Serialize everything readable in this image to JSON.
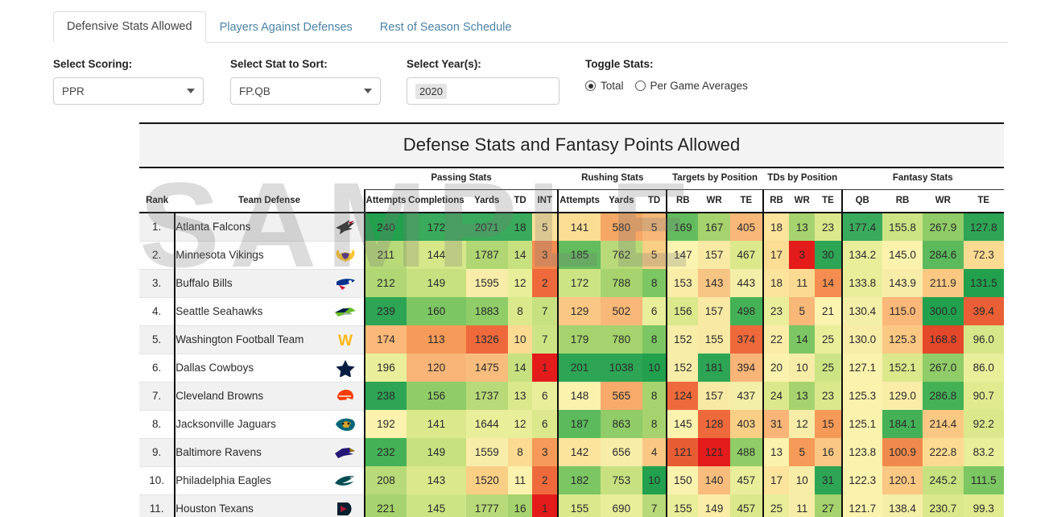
{
  "tabs": [
    {
      "label": "Defensive Stats Allowed",
      "active": true
    },
    {
      "label": "Players Against Defenses",
      "active": false
    },
    {
      "label": "Rest of Season Schedule",
      "active": false
    }
  ],
  "controls": {
    "scoring": {
      "label": "Select Scoring:",
      "value": "PPR"
    },
    "stat_sort": {
      "label": "Select Stat to Sort:",
      "value": "FP.QB"
    },
    "years": {
      "label": "Select Year(s):",
      "value": "2020"
    },
    "toggle": {
      "label": "Toggle Stats:",
      "options": [
        {
          "label": "Total",
          "selected": true
        },
        {
          "label": "Per Game Averages",
          "selected": false
        }
      ]
    }
  },
  "watermark": "SAMPLE",
  "table": {
    "title": "Defense Stats and Fantasy Points Allowed",
    "groups": [
      {
        "label": "",
        "span": 2,
        "rule": false
      },
      {
        "label": "Passing Stats",
        "span": 5,
        "rule": true
      },
      {
        "label": "Rushing Stats",
        "span": 3,
        "rule": true
      },
      {
        "label": "Targets by Position",
        "span": 3,
        "rule": true
      },
      {
        "label": "TDs by Position",
        "span": 3,
        "rule": true
      },
      {
        "label": "Fantasy Stats",
        "span": 4,
        "rule": true
      }
    ],
    "columns": [
      "Rank",
      "Team Defense",
      "Attempts",
      "Completions",
      "Yards",
      "TD",
      "INT",
      "Attempts",
      "Yards",
      "TD",
      "RB",
      "WR",
      "TE",
      "RB",
      "WR",
      "TE",
      "QB",
      "RB",
      "WR",
      "TE"
    ],
    "rows": [
      {
        "rank": "1.",
        "team": "Atlanta Falcons",
        "logo": "falcons",
        "cells": [
          {
            "v": "240",
            "c": "#22a04e"
          },
          {
            "v": "172",
            "c": "#3aaa5c"
          },
          {
            "v": "2071",
            "c": "#3aaa5c"
          },
          {
            "v": "18",
            "c": "#3aaa5c"
          },
          {
            "v": "5",
            "c": "#fde39a"
          },
          {
            "v": "141",
            "c": "#fcdd94"
          },
          {
            "v": "580",
            "c": "#f5a765"
          },
          {
            "v": "5",
            "c": "#f7b878"
          },
          {
            "v": "169",
            "c": "#63bc5e"
          },
          {
            "v": "167",
            "c": "#a6d36d"
          },
          {
            "v": "405",
            "c": "#f7b878"
          },
          {
            "v": "18",
            "c": "#fce49d"
          },
          {
            "v": "13",
            "c": "#a6d36d"
          },
          {
            "v": "23",
            "c": "#dbe88c"
          },
          {
            "v": "177.4",
            "c": "#3aaa5c"
          },
          {
            "v": "155.8",
            "c": "#cde485"
          },
          {
            "v": "267.9",
            "c": "#90cc68"
          },
          {
            "v": "127.8",
            "c": "#2ea455"
          }
        ]
      },
      {
        "rank": "2.",
        "team": "Minnesota Vikings",
        "logo": "vikings",
        "cells": [
          {
            "v": "211",
            "c": "#b8da78"
          },
          {
            "v": "144",
            "c": "#d6e789"
          },
          {
            "v": "1787",
            "c": "#b0d774"
          },
          {
            "v": "14",
            "c": "#c7e181"
          },
          {
            "v": "3",
            "c": "#f58d50"
          },
          {
            "v": "185",
            "c": "#63bc5e"
          },
          {
            "v": "762",
            "c": "#b8da78"
          },
          {
            "v": "5",
            "c": "#f9cf86"
          },
          {
            "v": "147",
            "c": "#fbf4b0"
          },
          {
            "v": "157",
            "c": "#f8e9a4"
          },
          {
            "v": "467",
            "c": "#dbe88c"
          },
          {
            "v": "17",
            "c": "#fcdd94"
          },
          {
            "v": "3",
            "c": "#e31b1b"
          },
          {
            "v": "30",
            "c": "#2ea455"
          },
          {
            "v": "134.2",
            "c": "#e9ee9b"
          },
          {
            "v": "145.0",
            "c": "#faf2ad"
          },
          {
            "v": "284.6",
            "c": "#5cba5c"
          },
          {
            "v": "72.3",
            "c": "#fbdb92"
          }
        ]
      },
      {
        "rank": "3.",
        "team": "Buffalo Bills",
        "logo": "bills",
        "cells": [
          {
            "v": "212",
            "c": "#b0d774"
          },
          {
            "v": "149",
            "c": "#c7e181"
          },
          {
            "v": "1595",
            "c": "#f7eda8"
          },
          {
            "v": "12",
            "c": "#e9ee9b"
          },
          {
            "v": "2",
            "c": "#ee6a3c"
          },
          {
            "v": "172",
            "c": "#cde485"
          },
          {
            "v": "788",
            "c": "#a6d36d"
          },
          {
            "v": "8",
            "c": "#7cc663"
          },
          {
            "v": "153",
            "c": "#f9eda8"
          },
          {
            "v": "143",
            "c": "#f7c583"
          },
          {
            "v": "443",
            "c": "#f4efa8"
          },
          {
            "v": "18",
            "c": "#fce49d"
          },
          {
            "v": "11",
            "c": "#fbdb92"
          },
          {
            "v": "14",
            "c": "#f58d50"
          },
          {
            "v": "133.8",
            "c": "#e9ee9b"
          },
          {
            "v": "143.9",
            "c": "#f7eda8"
          },
          {
            "v": "211.9",
            "c": "#fbc883"
          },
          {
            "v": "131.5",
            "c": "#22a04e"
          }
        ]
      },
      {
        "rank": "4.",
        "team": "Seattle Seahawks",
        "logo": "seahawks",
        "cells": [
          {
            "v": "239",
            "c": "#2ea455"
          },
          {
            "v": "160",
            "c": "#7cc663"
          },
          {
            "v": "1883",
            "c": "#90cc68"
          },
          {
            "v": "8",
            "c": "#dbe88c"
          },
          {
            "v": "7",
            "c": "#c7e181"
          },
          {
            "v": "129",
            "c": "#fbc883"
          },
          {
            "v": "502",
            "c": "#f7b878"
          },
          {
            "v": "6",
            "c": "#e9ee9b"
          },
          {
            "v": "156",
            "c": "#dbe88c"
          },
          {
            "v": "157",
            "c": "#f8e9a4"
          },
          {
            "v": "498",
            "c": "#45b157"
          },
          {
            "v": "23",
            "c": "#e9ee9b"
          },
          {
            "v": "5",
            "c": "#f7b878"
          },
          {
            "v": "21",
            "c": "#fbf4b0"
          },
          {
            "v": "130.4",
            "c": "#f4efa8"
          },
          {
            "v": "115.0",
            "c": "#fbb878"
          },
          {
            "v": "300.0",
            "c": "#22a04e"
          },
          {
            "v": "39.4",
            "c": "#ea5f35"
          }
        ]
      },
      {
        "rank": "5.",
        "team": "Washington Football Team",
        "logo": "washington",
        "cells": [
          {
            "v": "174",
            "c": "#fbb878"
          },
          {
            "v": "113",
            "c": "#f59a58"
          },
          {
            "v": "1326",
            "c": "#ee6a3c"
          },
          {
            "v": "10",
            "c": "#fbdb92"
          },
          {
            "v": "7",
            "c": "#cde485"
          },
          {
            "v": "179",
            "c": "#a6d36d"
          },
          {
            "v": "780",
            "c": "#a6d36d"
          },
          {
            "v": "8",
            "c": "#7cc663"
          },
          {
            "v": "152",
            "c": "#f7eda8"
          },
          {
            "v": "155",
            "c": "#f8e9a4"
          },
          {
            "v": "374",
            "c": "#ee6a3c"
          },
          {
            "v": "22",
            "c": "#f9eda8"
          },
          {
            "v": "14",
            "c": "#7cc663"
          },
          {
            "v": "25",
            "c": "#e9ee9b"
          },
          {
            "v": "130.0",
            "c": "#f7eda8"
          },
          {
            "v": "125.3",
            "c": "#fbc883"
          },
          {
            "v": "168.8",
            "c": "#e3482a"
          },
          {
            "v": "96.0",
            "c": "#d6e789"
          }
        ]
      },
      {
        "rank": "6.",
        "team": "Dallas Cowboys",
        "logo": "cowboys",
        "cells": [
          {
            "v": "196",
            "c": "#e9ee9b"
          },
          {
            "v": "120",
            "c": "#f9b577"
          },
          {
            "v": "1475",
            "c": "#f8bd7d"
          },
          {
            "v": "14",
            "c": "#c7e181"
          },
          {
            "v": "1",
            "c": "#e31b1b"
          },
          {
            "v": "201",
            "c": "#2ea455"
          },
          {
            "v": "1038",
            "c": "#2ea455"
          },
          {
            "v": "10",
            "c": "#22a04e"
          },
          {
            "v": "152",
            "c": "#f7eda8"
          },
          {
            "v": "181",
            "c": "#2ea455"
          },
          {
            "v": "394",
            "c": "#f9b577"
          },
          {
            "v": "20",
            "c": "#faf2ad"
          },
          {
            "v": "10",
            "c": "#f7eda8"
          },
          {
            "v": "25",
            "c": "#cde485"
          },
          {
            "v": "127.1",
            "c": "#faf2ad"
          },
          {
            "v": "152.1",
            "c": "#dbe88c"
          },
          {
            "v": "267.0",
            "c": "#90cc68"
          },
          {
            "v": "86.0",
            "c": "#e9ee9b"
          }
        ]
      },
      {
        "rank": "7.",
        "team": "Cleveland Browns",
        "logo": "browns",
        "cells": [
          {
            "v": "238",
            "c": "#2ea455"
          },
          {
            "v": "156",
            "c": "#90cc68"
          },
          {
            "v": "1737",
            "c": "#b8da78"
          },
          {
            "v": "13",
            "c": "#dbe88c"
          },
          {
            "v": "6",
            "c": "#e9ee9b"
          },
          {
            "v": "148",
            "c": "#faf2ad"
          },
          {
            "v": "565",
            "c": "#f7aa6a"
          },
          {
            "v": "8",
            "c": "#a6d36d"
          },
          {
            "v": "124",
            "c": "#ee6a3c"
          },
          {
            "v": "157",
            "c": "#f8e9a4"
          },
          {
            "v": "437",
            "c": "#f4efa8"
          },
          {
            "v": "24",
            "c": "#dbe88c"
          },
          {
            "v": "13",
            "c": "#a6d36d"
          },
          {
            "v": "23",
            "c": "#dbe88c"
          },
          {
            "v": "125.3",
            "c": "#faf2ad"
          },
          {
            "v": "129.0",
            "c": "#f9eda8"
          },
          {
            "v": "286.8",
            "c": "#45b157"
          },
          {
            "v": "90.7",
            "c": "#e0eb90"
          }
        ]
      },
      {
        "rank": "8.",
        "team": "Jacksonville Jaguars",
        "logo": "jaguars",
        "cells": [
          {
            "v": "192",
            "c": "#faf2ad"
          },
          {
            "v": "141",
            "c": "#dbe88c"
          },
          {
            "v": "1644",
            "c": "#e9ee9b"
          },
          {
            "v": "12",
            "c": "#e9ee9b"
          },
          {
            "v": "6",
            "c": "#dbe88c"
          },
          {
            "v": "187",
            "c": "#5cba5c"
          },
          {
            "v": "863",
            "c": "#90cc68"
          },
          {
            "v": "8",
            "c": "#a6d36d"
          },
          {
            "v": "145",
            "c": "#faf2ad"
          },
          {
            "v": "128",
            "c": "#ee6a3c"
          },
          {
            "v": "403",
            "c": "#f9cf86"
          },
          {
            "v": "31",
            "c": "#f9b577"
          },
          {
            "v": "12",
            "c": "#f7eda8"
          },
          {
            "v": "15",
            "c": "#f59a58"
          },
          {
            "v": "125.1",
            "c": "#faf2ad"
          },
          {
            "v": "184.1",
            "c": "#45b157"
          },
          {
            "v": "214.4",
            "c": "#fbc883"
          },
          {
            "v": "92.2",
            "c": "#dbe88c"
          }
        ]
      },
      {
        "rank": "9.",
        "team": "Baltimore Ravens",
        "logo": "ravens",
        "cells": [
          {
            "v": "232",
            "c": "#45b157"
          },
          {
            "v": "149",
            "c": "#c7e181"
          },
          {
            "v": "1559",
            "c": "#f7eda8"
          },
          {
            "v": "8",
            "c": "#fbdb92"
          },
          {
            "v": "3",
            "c": "#f59a58"
          },
          {
            "v": "142",
            "c": "#fce49d"
          },
          {
            "v": "656",
            "c": "#f7eda8"
          },
          {
            "v": "4",
            "c": "#fbc883"
          },
          {
            "v": "121",
            "c": "#e85c34"
          },
          {
            "v": "121",
            "c": "#e31b1b"
          },
          {
            "v": "488",
            "c": "#90cc68"
          },
          {
            "v": "13",
            "c": "#faf2ad"
          },
          {
            "v": "5",
            "c": "#f59a58"
          },
          {
            "v": "16",
            "c": "#fbc883"
          },
          {
            "v": "123.8",
            "c": "#faf2ad"
          },
          {
            "v": "100.9",
            "c": "#f08a4c"
          },
          {
            "v": "222.8",
            "c": "#fbdb92"
          },
          {
            "v": "83.2",
            "c": "#e9ee9b"
          }
        ]
      },
      {
        "rank": "10.",
        "team": "Philadelphia Eagles",
        "logo": "eagles",
        "cells": [
          {
            "v": "208",
            "c": "#b8da78"
          },
          {
            "v": "143",
            "c": "#dbe88c"
          },
          {
            "v": "1520",
            "c": "#f9cf86"
          },
          {
            "v": "11",
            "c": "#faf2ad"
          },
          {
            "v": "2",
            "c": "#ee6a3c"
          },
          {
            "v": "182",
            "c": "#7cc663"
          },
          {
            "v": "753",
            "c": "#c7e181"
          },
          {
            "v": "10",
            "c": "#22a04e"
          },
          {
            "v": "150",
            "c": "#faf2ad"
          },
          {
            "v": "140",
            "c": "#f8bd7d"
          },
          {
            "v": "457",
            "c": "#e9ee9b"
          },
          {
            "v": "17",
            "c": "#fce49d"
          },
          {
            "v": "10",
            "c": "#f7eda8"
          },
          {
            "v": "31",
            "c": "#2ea455"
          },
          {
            "v": "122.3",
            "c": "#faf2ad"
          },
          {
            "v": "120.1",
            "c": "#fbc883"
          },
          {
            "v": "245.2",
            "c": "#c7e181"
          },
          {
            "v": "111.5",
            "c": "#7cc663"
          }
        ]
      },
      {
        "rank": "11.",
        "team": "Houston Texans",
        "logo": "texans",
        "cells": [
          {
            "v": "221",
            "c": "#a6d36d"
          },
          {
            "v": "145",
            "c": "#cde485"
          },
          {
            "v": "1777",
            "c": "#b8da78"
          },
          {
            "v": "16",
            "c": "#a6d36d"
          },
          {
            "v": "1",
            "c": "#e31b1b"
          },
          {
            "v": "155",
            "c": "#dbe88c"
          },
          {
            "v": "690",
            "c": "#e9ee9b"
          },
          {
            "v": "7",
            "c": "#b8da78"
          },
          {
            "v": "155",
            "c": "#e9ee9b"
          },
          {
            "v": "149",
            "c": "#f9eda8"
          },
          {
            "v": "457",
            "c": "#dbe88c"
          },
          {
            "v": "25",
            "c": "#e9ee9b"
          },
          {
            "v": "11",
            "c": "#f7eda8"
          },
          {
            "v": "27",
            "c": "#a6d36d"
          },
          {
            "v": "121.7",
            "c": "#faf2ad"
          },
          {
            "v": "138.4",
            "c": "#f4efa8"
          },
          {
            "v": "230.7",
            "c": "#dbe88c"
          },
          {
            "v": "99.3",
            "c": "#e0eb90"
          }
        ]
      }
    ]
  }
}
